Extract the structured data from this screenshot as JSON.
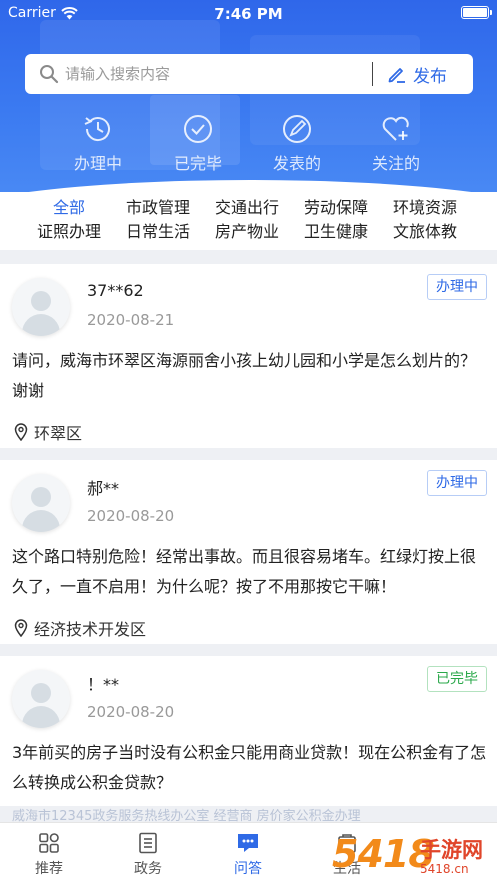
{
  "status_bar": {
    "carrier": "Carrier",
    "time": "7:46 PM"
  },
  "search": {
    "placeholder": "请输入搜索内容",
    "publish_label": "发布"
  },
  "status_tabs": [
    {
      "label": "办理中",
      "icon": "clock-history-icon"
    },
    {
      "label": "已完毕",
      "icon": "check-circle-icon"
    },
    {
      "label": "发表的",
      "icon": "pen-circle-icon"
    },
    {
      "label": "关注的",
      "icon": "heart-plus-icon"
    }
  ],
  "categories": {
    "row1": [
      "全部",
      "市政管理",
      "交通出行",
      "劳动保障",
      "环境资源"
    ],
    "row2": [
      "证照办理",
      "日常生活",
      "房产物业",
      "卫生健康",
      "文旅体教"
    ],
    "active": "全部"
  },
  "posts": [
    {
      "user": "37**62",
      "date": "2020-08-21",
      "status": "办理中",
      "status_type": "processing",
      "content": "请问，威海市环翠区海源丽舍小孩上幼儿园和小学是怎么划片的？谢谢",
      "location": "环翠区"
    },
    {
      "user": "郝**",
      "date": "2020-08-20",
      "status": "办理中",
      "status_type": "processing",
      "content": "这个路口特别危险！经常出事故。而且很容易堵车。红绿灯按上很久了，一直不启用！为什么呢？按了不用那按它干嘛！",
      "location": "经济技术开发区"
    },
    {
      "user": "！**",
      "date": "2020-08-20",
      "status": "已完毕",
      "status_type": "done",
      "content": "3年前买的房子当时没有公积金只能用商业贷款！现在公积金有了怎么转换成公积金贷款？",
      "location": ""
    }
  ],
  "peek_text": "威海市12345政务服务热线办公室 经营商 房价家公积金办理",
  "bottom_nav": [
    {
      "label": "推荐",
      "icon": "grid-icon"
    },
    {
      "label": "政务",
      "icon": "document-list-icon"
    },
    {
      "label": "问答",
      "icon": "chat-bubble-icon"
    },
    {
      "label": "生活",
      "icon": "life-icon"
    }
  ],
  "bottom_nav_active": "问答",
  "watermark": {
    "number": "5418",
    "text": "手游网",
    "url": "5418.cn"
  },
  "colors": {
    "primary": "#2f6ae6",
    "done": "#2aa84a",
    "header_top": "#2f67ea"
  }
}
